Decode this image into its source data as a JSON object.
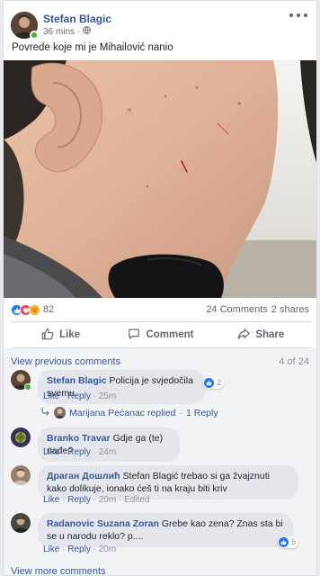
{
  "post": {
    "author": "Stefan Blagic",
    "time": "36 mins",
    "privacy_icon": "globe-icon",
    "text": "Povrede koje mi je Mihailović nanio"
  },
  "reactions": {
    "icons": [
      "like",
      "love",
      "sad"
    ],
    "count": "82",
    "comments": "24 Comments",
    "shares": "2 shares"
  },
  "actions": {
    "like": "Like",
    "comment": "Comment",
    "share": "Share"
  },
  "comments": {
    "view_previous": "View previous comments",
    "page": "4 of 24",
    "items": [
      {
        "name": "Stefan Blagic",
        "text": "Policija je svjedočila svemu.",
        "like": "Like",
        "reply": "Reply",
        "time": "25m",
        "reactions": "2",
        "edited": ""
      },
      {
        "name": "Branko Travar",
        "text": "Gdje ga (te) nađe?",
        "like": "Like",
        "reply": "Reply",
        "time": "24m",
        "reactions": "",
        "edited": ""
      },
      {
        "name": "Драган Дошлић",
        "text": "Stefan Blagić trebao si ga žvajznuti kako dolikuje, ionako ćeš ti na kraju biti kriv",
        "like": "Like",
        "reply": "Reply",
        "time": "20m",
        "reactions": "",
        "edited": "Edited"
      },
      {
        "name": "Radanovic Suzana Zoran",
        "text": "Grebe kao zena? Znas sta bi se u narodu reklo? p....",
        "like": "Like",
        "reply": "Reply",
        "time": "20m",
        "reactions": "5",
        "edited": ""
      }
    ],
    "reply_summary": {
      "name": "Marijana Pećanac replied",
      "count": "1 Reply"
    },
    "view_more": "View more comments"
  },
  "colors": {
    "link_blue": "#365899",
    "facebook_blue": "#1877f2",
    "muted_gray": "#90949c",
    "bubble_gray": "#e4e6eb",
    "online_green": "#42b72a"
  }
}
